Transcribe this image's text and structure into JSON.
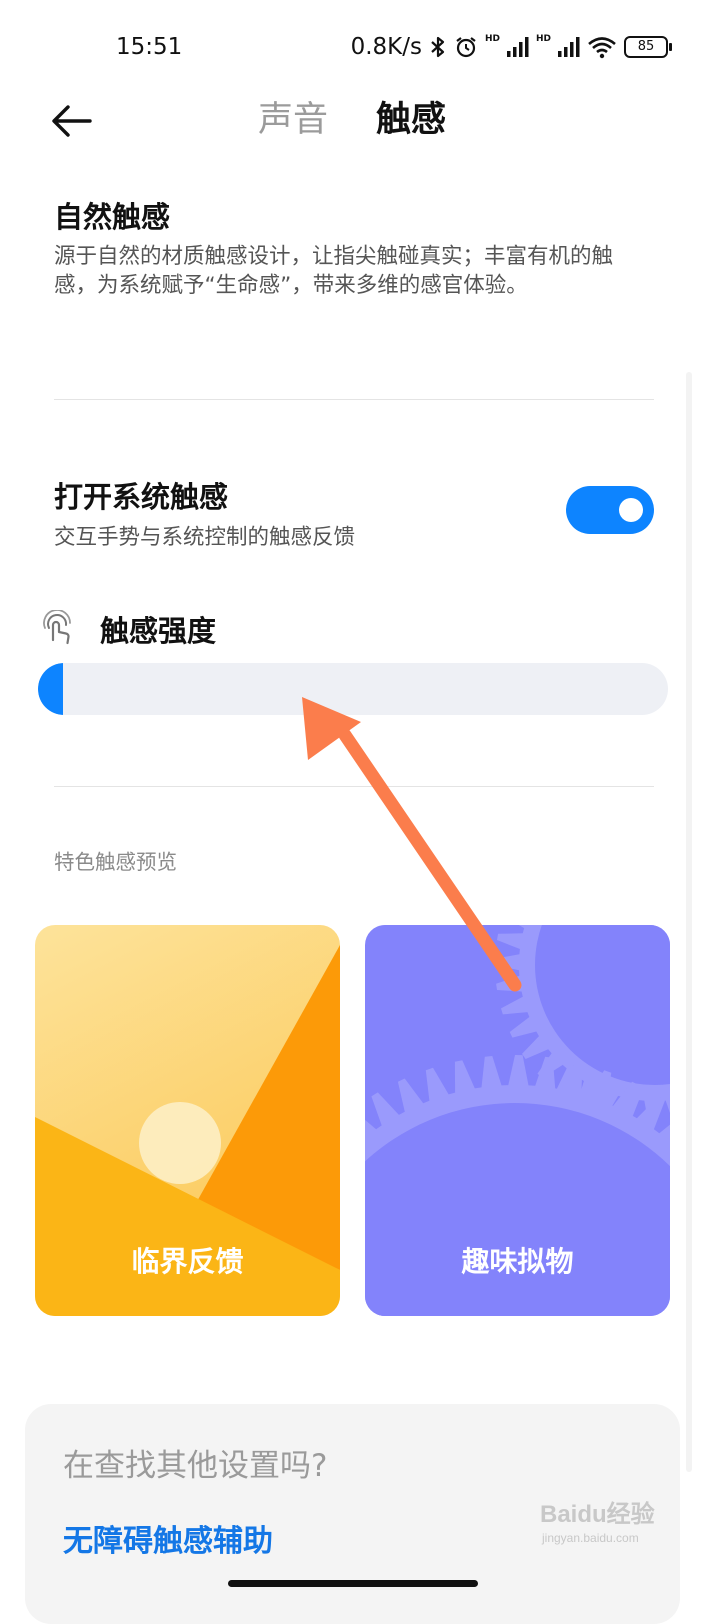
{
  "status_bar": {
    "time": "15:51",
    "net_speed": "0.8K/s",
    "signal1_label": "HD",
    "signal2_label": "HD",
    "battery": "85"
  },
  "header": {
    "tabs": [
      {
        "label": "声音",
        "active": false
      },
      {
        "label": "触感",
        "active": true
      }
    ]
  },
  "natural_haptics": {
    "title": "自然触感",
    "description": "源于自然的材质触感设计，让指尖触碰真实；丰富有机的触感，为系统赋予“生命感”，带来多维的感官体验。"
  },
  "system_haptics": {
    "title": "打开系统触感",
    "description": "交互手势与系统控制的触感反馈",
    "enabled": true
  },
  "intensity": {
    "label": "触感强度",
    "value_fraction": 0.04
  },
  "preview": {
    "section_label": "特色触感预览",
    "cards": [
      {
        "label": "临界反馈"
      },
      {
        "label": "趣味拟物"
      }
    ]
  },
  "search_more": {
    "question": "在查找其他设置吗?",
    "link": "无障碍触感辅助"
  },
  "watermark": {
    "text": "Baidu经验",
    "sub": "jingyan.baidu.com"
  },
  "colors": {
    "accent": "#0d84ff",
    "card_left": "#fbb516",
    "card_right": "#8383fb",
    "annotation_arrow": "#fb7d4c",
    "link": "#1477e6"
  }
}
